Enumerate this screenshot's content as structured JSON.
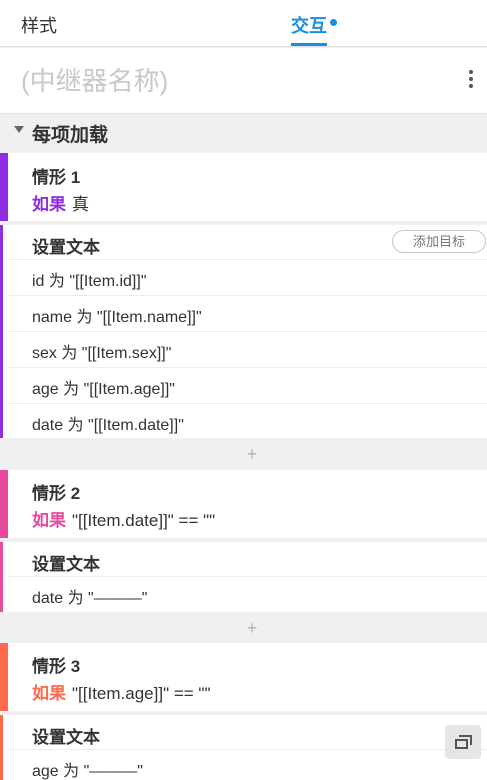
{
  "tabs": {
    "style": "样式",
    "interaction": "交互"
  },
  "name_placeholder": "(中继器名称)",
  "event": {
    "title": "每项加载"
  },
  "cases": [
    {
      "title": "情形 1",
      "condition_keyword": "如果",
      "condition_text": "真",
      "color": "#8e2de2",
      "action": {
        "title": "设置文本",
        "add_target": "添加目标",
        "rows": [
          "id 为 \"[[Item.id]]\"",
          "name 为 \"[[Item.name]]\"",
          "sex 为 \"[[Item.sex]]\"",
          "age 为 \"[[Item.age]]\"",
          "date 为 \"[[Item.date]]\""
        ]
      }
    },
    {
      "title": "情形 2",
      "condition_keyword": "如果",
      "condition_text": "\"[[Item.date]]\" == \"\"",
      "color": "#e84a9c",
      "action": {
        "title": "设置文本",
        "rows": [
          "date 为 \"———\""
        ]
      }
    },
    {
      "title": "情形 3",
      "condition_keyword": "如果",
      "condition_text": "\"[[Item.age]]\" == \"\"",
      "color": "#ff6b4a",
      "action": {
        "title": "设置文本",
        "rows": [
          "age 为 \"———\""
        ]
      }
    }
  ],
  "plus_symbol": "+",
  "colors": {
    "accent": "#1a8fe0",
    "case1": "#8e2de2",
    "case2": "#e84a9c",
    "case3": "#ff6b4a"
  }
}
